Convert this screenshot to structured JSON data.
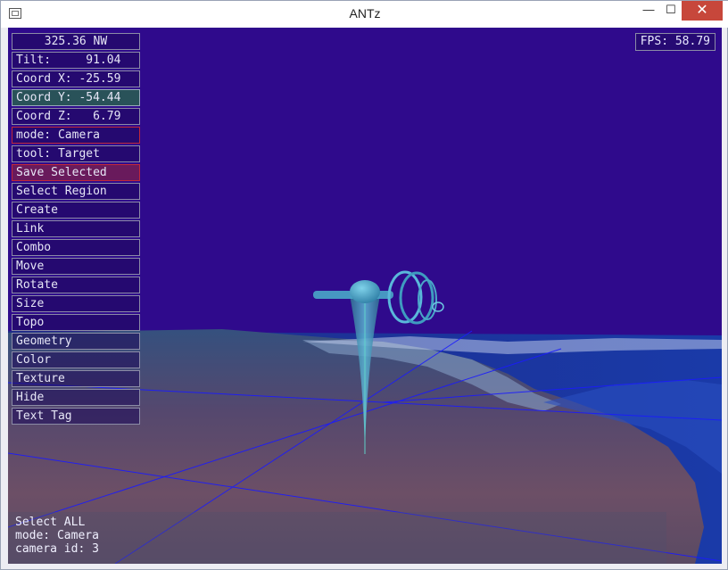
{
  "window": {
    "title": "ANTz",
    "minimize_glyph": "—",
    "maximize_glyph": "☐",
    "close_glyph": "✕"
  },
  "hud": {
    "fps": "FPS: 58.79",
    "menu": [
      {
        "label": "325.36 NW"
      },
      {
        "label": "Tilt:     91.04"
      },
      {
        "label": "Coord X: -25.59"
      },
      {
        "label": "Coord Y: -54.44"
      },
      {
        "label": "Coord Z:   6.79"
      },
      {
        "label": "mode: Camera"
      },
      {
        "label": "tool: Target"
      },
      {
        "label": "Save Selected"
      },
      {
        "label": "Select Region"
      },
      {
        "label": "Create"
      },
      {
        "label": "Link"
      },
      {
        "label": "Combo"
      },
      {
        "label": "Move"
      },
      {
        "label": "Rotate"
      },
      {
        "label": "Size"
      },
      {
        "label": "Topo"
      },
      {
        "label": "Geometry"
      },
      {
        "label": "Color"
      },
      {
        "label": "Texture"
      },
      {
        "label": "Hide"
      },
      {
        "label": "Text Tag"
      }
    ],
    "status": {
      "line1": "Select ALL",
      "line2": "mode: Camera",
      "line3": "camera id: 3"
    }
  },
  "colors": {
    "sky": "#2f0a8c",
    "object": "#4aa6c8",
    "grid_lines": "#1a1aff"
  }
}
